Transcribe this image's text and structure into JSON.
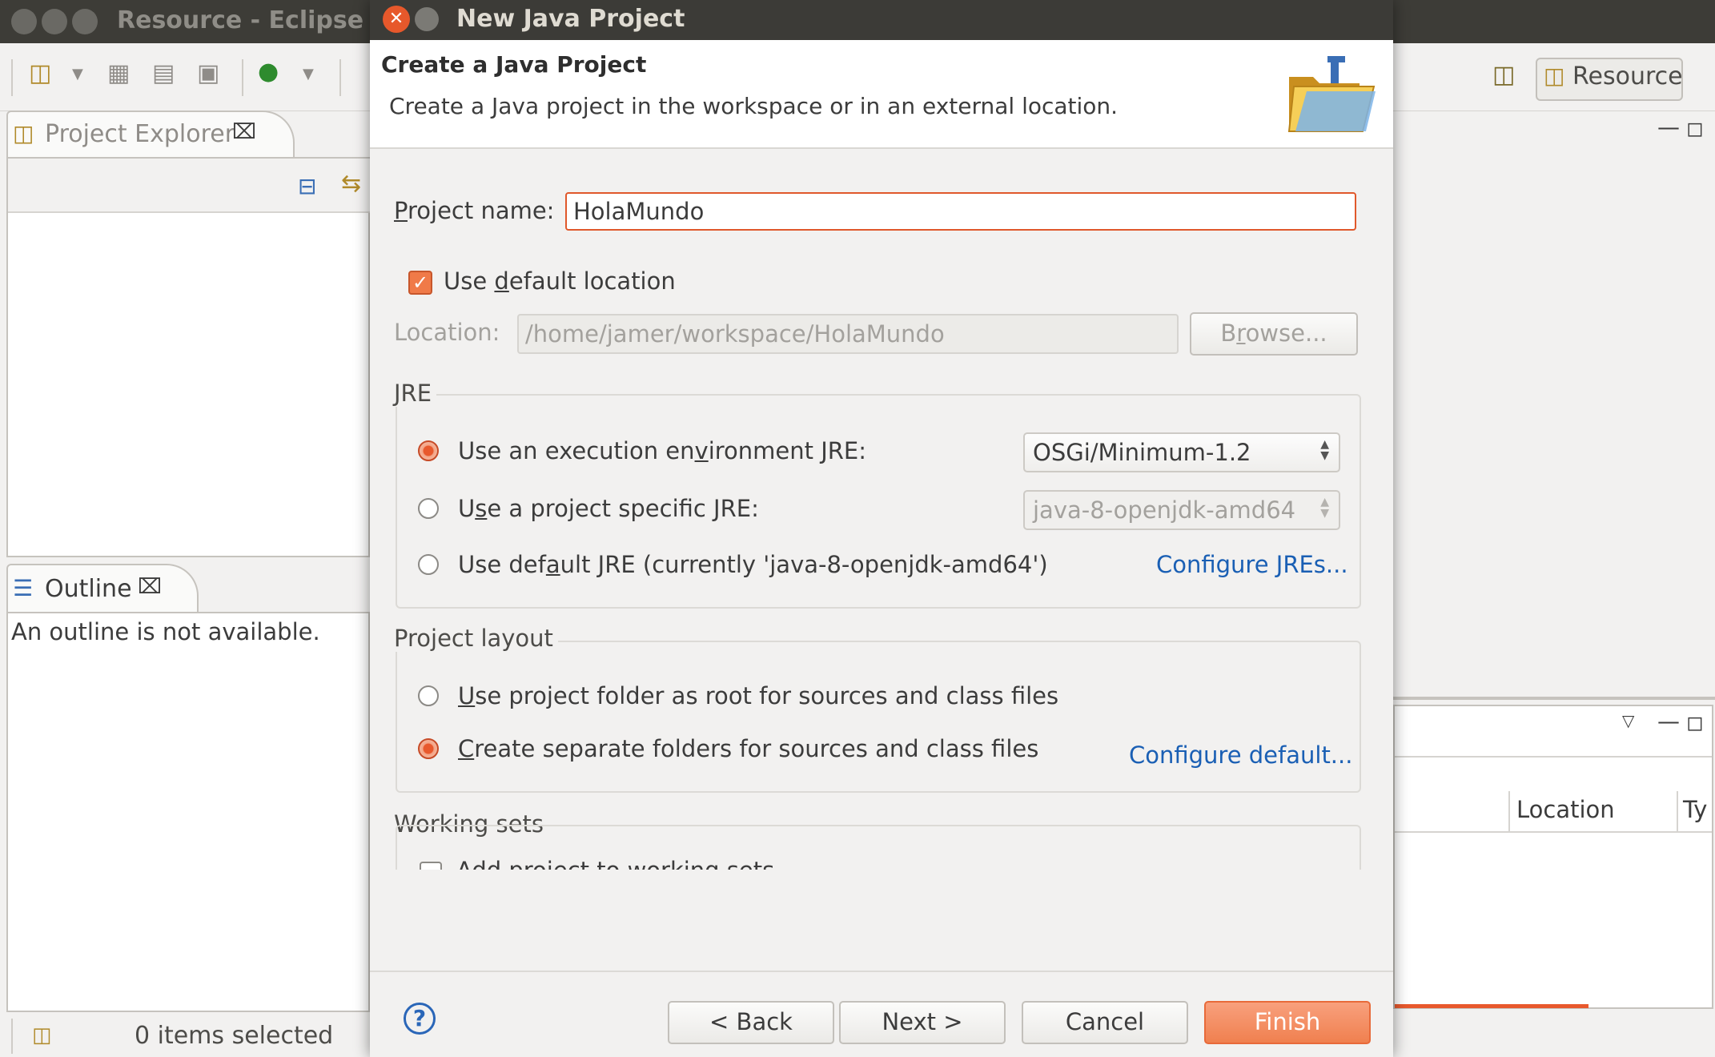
{
  "eclipse": {
    "title": "Resource - Eclipse Platform",
    "perspective_label": "Resource",
    "project_explorer_tab": "Project Explorer",
    "outline_tab": "Outline",
    "outline_message": "An outline is not available.",
    "status": "0 items selected",
    "problems_columns": [
      "Location",
      "Ty"
    ]
  },
  "dialog": {
    "title": "New Java Project",
    "banner_title": "Create a Java Project",
    "banner_description": "Create a Java project in the workspace or in an external location.",
    "project_name_label_prefix": "",
    "project_name_label_u": "P",
    "project_name_label_rest": "roject name:",
    "project_name_value": "HolaMundo",
    "default_location": {
      "checked": true,
      "pre": "Use ",
      "u": "d",
      "post": "efault location"
    },
    "location_label": "Location:",
    "location_value": "/home/jamer/workspace/HolaMundo",
    "browse_pre": "B",
    "browse_u": "r",
    "browse_post": "owse...",
    "jre": {
      "group_title": "JRE",
      "opt1_pre": "Use an execution en",
      "opt1_u": "v",
      "opt1_post": "ironment JRE:",
      "opt1_value": "OSGi/Minimum-1.2",
      "opt2_pre": "U",
      "opt2_u": "s",
      "opt2_post": "e a project specific JRE:",
      "opt2_value": "java-8-openjdk-amd64",
      "opt3_pre": "Use def",
      "opt3_u": "a",
      "opt3_post": "ult JRE (currently 'java-8-openjdk-amd64')",
      "configure_link": "Configure JREs...",
      "selected": 1
    },
    "layout": {
      "group_title": "Project layout",
      "opt1_u": "U",
      "opt1_post": "se project folder as root for sources and class files",
      "opt2_u": "C",
      "opt2_post": "reate separate folders for sources and class files",
      "configure_link": "Configure default...",
      "selected": 2
    },
    "working_sets": {
      "group_title": "Working sets",
      "add_label": "Add project to working sets"
    },
    "buttons": {
      "help": "?",
      "back": "< Back",
      "next": "Next >",
      "cancel": "Cancel",
      "finish": "Finish"
    }
  },
  "colors": {
    "accent": "#e8592d",
    "link": "#1a5fb4",
    "titlebar": "#3c3b37"
  }
}
